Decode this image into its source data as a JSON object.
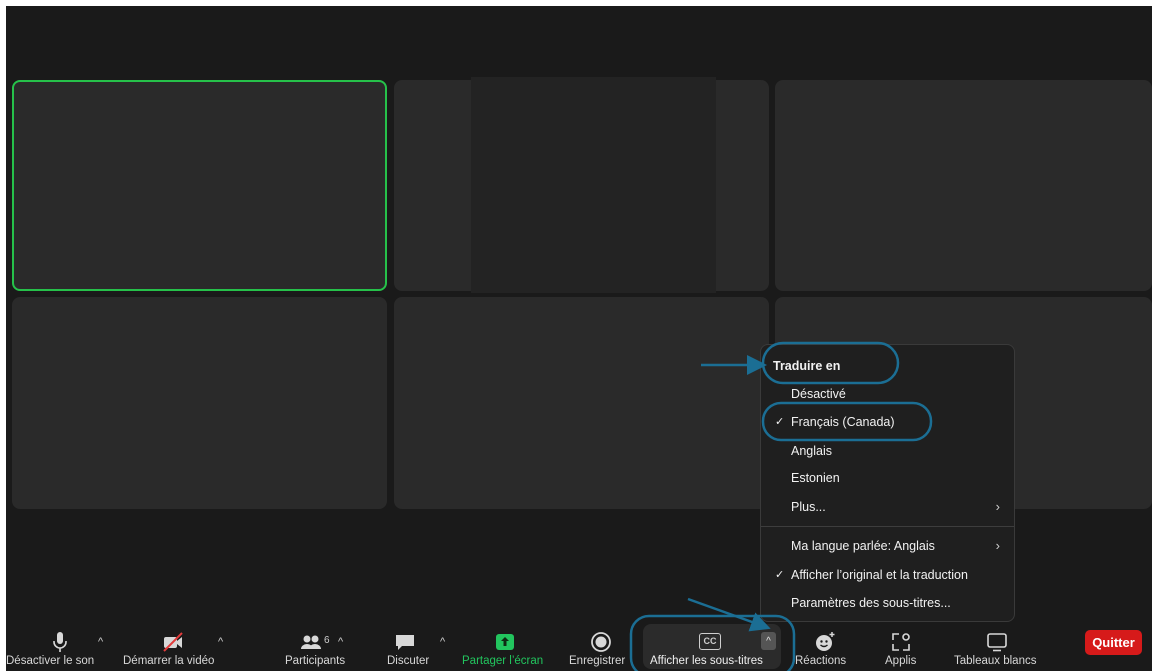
{
  "menu": {
    "header": "Traduire en",
    "items": [
      {
        "label": "Désactivé",
        "checked": false
      },
      {
        "label": "Français (Canada)",
        "checked": true
      },
      {
        "label": "Anglais",
        "checked": false
      },
      {
        "label": "Estonien",
        "checked": false
      },
      {
        "label": "Plus...",
        "checked": false
      }
    ],
    "spoken_language": "Ma langue parlée: Anglais",
    "show_original": "Afficher l’original et la traduction",
    "caption_settings": "Paramètres des sous-titres..."
  },
  "toolbar": {
    "mute": "Désactiver le son",
    "start_video": "Démarrer la vidéo",
    "participants": "Participants",
    "participants_count": "6",
    "chat": "Discuter",
    "share": "Partager l’écran",
    "record": "Enregistrer",
    "captions": "Afficher les sous-titres",
    "cc_badge": "CC",
    "reactions": "Réactions",
    "apps": "Applis",
    "whiteboards": "Tableaux blancs",
    "quit": "Quitter"
  },
  "colors": {
    "active_speaker": "#26c14a",
    "share_green": "#22c55e",
    "quit_red": "#d61a1a",
    "annotation_blue": "#1b6e94"
  }
}
